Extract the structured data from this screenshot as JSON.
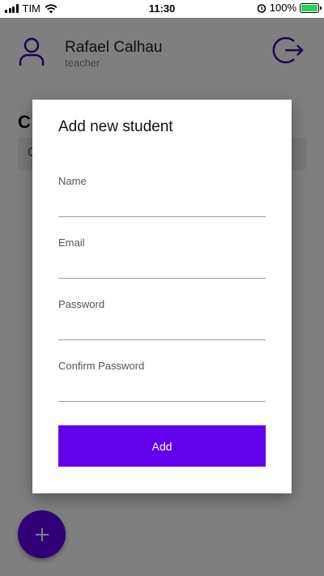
{
  "status_bar": {
    "carrier": "TIM",
    "time": "11:30",
    "battery": "100%"
  },
  "header": {
    "user_name": "Rafael Calhau",
    "user_role": "teacher",
    "avatar_icon": "person-icon",
    "logout_icon": "logout-icon"
  },
  "main": {
    "section_title_partial": "C",
    "search_text_partial": "C"
  },
  "fab": {
    "label": "+"
  },
  "dialog": {
    "title": "Add new student",
    "fields": [
      {
        "label": "Name",
        "value": ""
      },
      {
        "label": "Email",
        "value": ""
      },
      {
        "label": "Password",
        "value": ""
      },
      {
        "label": "Confirm Password",
        "value": ""
      }
    ],
    "add_label": "Add"
  },
  "colors": {
    "primary": "#6200ee",
    "overlay": "rgba(0,0,0,0.5)"
  }
}
